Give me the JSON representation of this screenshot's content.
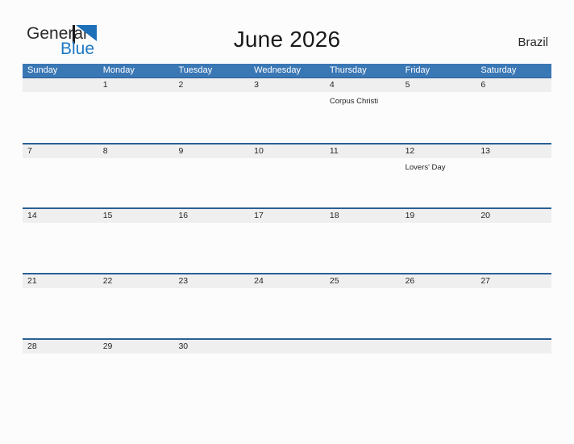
{
  "brand": {
    "text_primary": "General",
    "text_secondary": "Blue",
    "mark_icon": "triangle-logo-icon",
    "color_primary": "#2b2b2b",
    "color_secondary": "#1d77c4",
    "mark_color": "#1d70b8"
  },
  "header": {
    "title": "June 2026",
    "region": "Brazil"
  },
  "colors": {
    "header_bar": "#3a77b5",
    "row_band": "#efeff0",
    "row_rule": "#2a6096",
    "page_background": "#fcfcfc",
    "text": "#262626"
  },
  "weekdays": [
    "Sunday",
    "Monday",
    "Tuesday",
    "Wednesday",
    "Thursday",
    "Friday",
    "Saturday"
  ],
  "weeks": [
    {
      "days": [
        {
          "number": "",
          "event": ""
        },
        {
          "number": "1",
          "event": ""
        },
        {
          "number": "2",
          "event": ""
        },
        {
          "number": "3",
          "event": ""
        },
        {
          "number": "4",
          "event": "Corpus Christi"
        },
        {
          "number": "5",
          "event": ""
        },
        {
          "number": "6",
          "event": ""
        }
      ]
    },
    {
      "days": [
        {
          "number": "7",
          "event": ""
        },
        {
          "number": "8",
          "event": ""
        },
        {
          "number": "9",
          "event": ""
        },
        {
          "number": "10",
          "event": ""
        },
        {
          "number": "11",
          "event": ""
        },
        {
          "number": "12",
          "event": "Lovers' Day"
        },
        {
          "number": "13",
          "event": ""
        }
      ]
    },
    {
      "days": [
        {
          "number": "14",
          "event": ""
        },
        {
          "number": "15",
          "event": ""
        },
        {
          "number": "16",
          "event": ""
        },
        {
          "number": "17",
          "event": ""
        },
        {
          "number": "18",
          "event": ""
        },
        {
          "number": "19",
          "event": ""
        },
        {
          "number": "20",
          "event": ""
        }
      ]
    },
    {
      "days": [
        {
          "number": "21",
          "event": ""
        },
        {
          "number": "22",
          "event": ""
        },
        {
          "number": "23",
          "event": ""
        },
        {
          "number": "24",
          "event": ""
        },
        {
          "number": "25",
          "event": ""
        },
        {
          "number": "26",
          "event": ""
        },
        {
          "number": "27",
          "event": ""
        }
      ]
    },
    {
      "days": [
        {
          "number": "28",
          "event": ""
        },
        {
          "number": "29",
          "event": ""
        },
        {
          "number": "30",
          "event": ""
        },
        {
          "number": "",
          "event": ""
        },
        {
          "number": "",
          "event": ""
        },
        {
          "number": "",
          "event": ""
        },
        {
          "number": "",
          "event": ""
        }
      ]
    }
  ]
}
